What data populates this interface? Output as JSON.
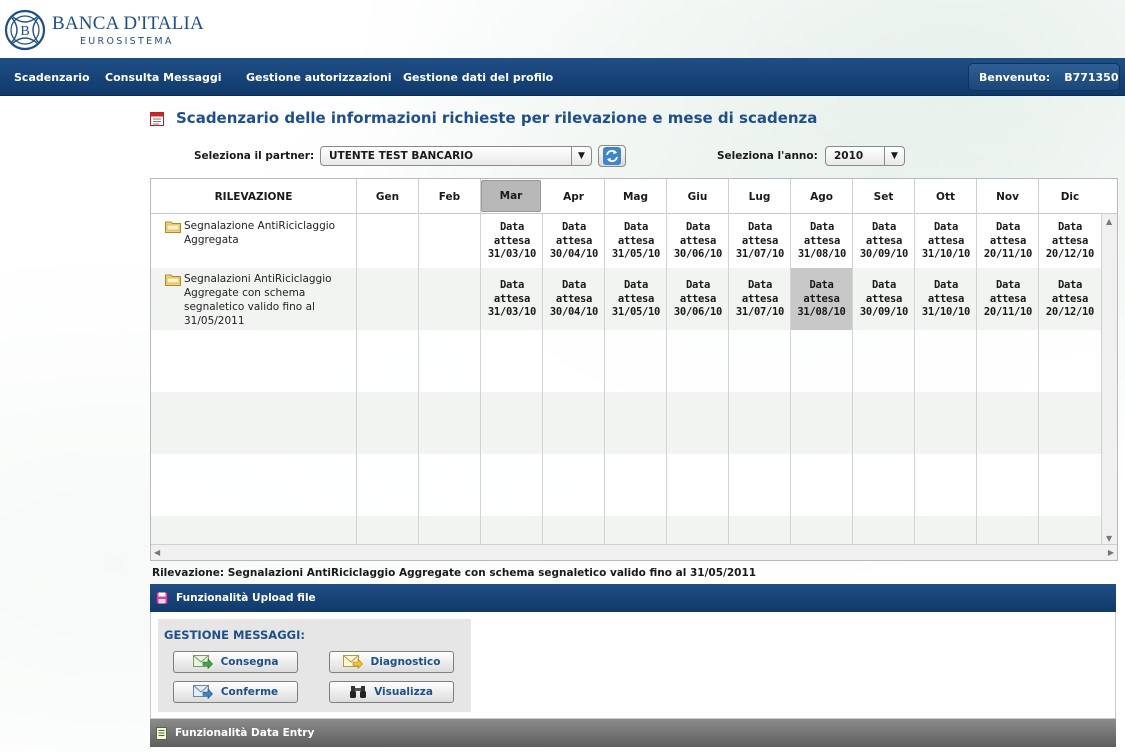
{
  "brand": {
    "title": "BANCA D'ITALIA",
    "subtitle": "EUROSISTEMA",
    "seal_text": "B"
  },
  "nav": {
    "items": [
      {
        "label": "Scadenzario"
      },
      {
        "label": "Consulta Messaggi"
      },
      {
        "label": "Gestione autorizzazioni"
      },
      {
        "label": "Gestione dati del profilo"
      }
    ],
    "welcome_label": "Benvenuto:",
    "user": "B771350"
  },
  "page": {
    "title": "Scadenzario delle informazioni richieste per rilevazione e mese di scadenza"
  },
  "filters": {
    "partner_label": "Seleziona il partner:",
    "partner_value": "UTENTE TEST BANCARIO",
    "year_label": "Seleziona l'anno:",
    "year_value": "2010",
    "dropdown_glyph": "▼"
  },
  "grid": {
    "columns": [
      "RILEVAZIONE",
      "Gen",
      "Feb",
      "Mar",
      "Apr",
      "Mag",
      "Giu",
      "Lug",
      "Ago",
      "Set",
      "Ott",
      "Nov",
      "Dic"
    ],
    "active_column": "Mar",
    "rows": [
      {
        "name": "Segnalazione AntiRiciclaggio Aggregata",
        "cells": {
          "Mar": [
            "Data",
            "attesa",
            "31/03/10"
          ],
          "Apr": [
            "Data",
            "attesa",
            "30/04/10"
          ],
          "Mag": [
            "Data",
            "attesa",
            "31/05/10"
          ],
          "Giu": [
            "Data",
            "attesa",
            "30/06/10"
          ],
          "Lug": [
            "Data",
            "attesa",
            "31/07/10"
          ],
          "Ago": [
            "Data",
            "attesa",
            "31/08/10"
          ],
          "Set": [
            "Data",
            "attesa",
            "30/09/10"
          ],
          "Ott": [
            "Data",
            "attesa",
            "31/10/10"
          ],
          "Nov": [
            "Data",
            "attesa",
            "20/11/10"
          ],
          "Dic": [
            "Data",
            "attesa",
            "20/12/10"
          ]
        }
      },
      {
        "name": "Segnalazioni AntiRiciclaggio Aggregate con schema segnaletico valido fino al 31/05/2011",
        "selected_cell": "Ago",
        "cells": {
          "Mar": [
            "Data",
            "attesa",
            "31/03/10"
          ],
          "Apr": [
            "Data",
            "attesa",
            "30/04/10"
          ],
          "Mag": [
            "Data",
            "attesa",
            "31/05/10"
          ],
          "Giu": [
            "Data",
            "attesa",
            "30/06/10"
          ],
          "Lug": [
            "Data",
            "attesa",
            "31/07/10"
          ],
          "Ago": [
            "Data",
            "attesa",
            "31/08/10"
          ],
          "Set": [
            "Data",
            "attesa",
            "30/09/10"
          ],
          "Ott": [
            "Data",
            "attesa",
            "31/10/10"
          ],
          "Nov": [
            "Data",
            "attesa",
            "20/11/10"
          ],
          "Dic": [
            "Data",
            "attesa",
            "20/12/10"
          ]
        }
      }
    ]
  },
  "detail": {
    "text": "Rilevazione: Segnalazioni AntiRiciclaggio Aggregate con schema segnaletico valido fino al 31/05/2011"
  },
  "upload_panel": {
    "title": "Funzionalità Upload file",
    "section_title": "GESTIONE MESSAGGI:",
    "buttons": {
      "consegna": "Consegna",
      "diagnostico": "Diagnostico",
      "conferme": "Conferme",
      "visualizza": "Visualizza"
    }
  },
  "data_entry_panel": {
    "title": "Funzionalità Data Entry"
  },
  "colors": {
    "brand_blue": "#1e4f8a",
    "nav_bg": "#1f4e86",
    "highlight_gray": "#b8b8b8"
  }
}
